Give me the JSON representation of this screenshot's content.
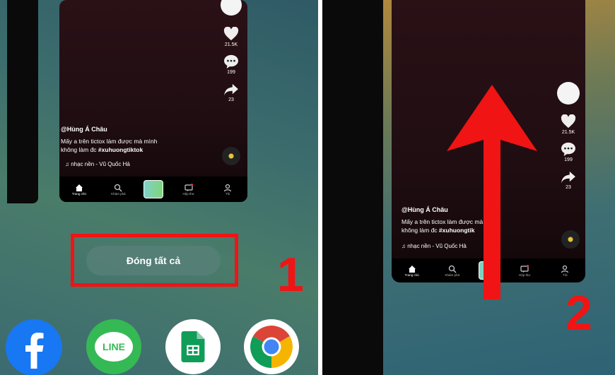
{
  "left_card": {
    "likes": "21.5K",
    "comments": "199",
    "shares": "23",
    "username": "@Hùng Á Châu",
    "caption_line1": "Mấy a trên tictox làm được mà mình",
    "caption_line2_prefix": "không làm đc ",
    "caption_hashtag": "#xuhuongtiktok",
    "music": "♫  nhạc nền - Vũ Quốc Hả"
  },
  "right_card": {
    "likes": "21.5K",
    "comments": "199",
    "shares": "23",
    "username": "@Hùng Á Châu",
    "caption_line1": "Mấy a trên tictox làm được mà minh",
    "caption_line2_prefix": "không làm đc ",
    "caption_hashtag": "#xuhuongtik",
    "music": "♫  nhạc nền - Vũ Quốc Hả"
  },
  "nav": {
    "home": "Trang chủ",
    "discover": "Khám phá",
    "inbox": "Hộp thư",
    "profile": "Tôi"
  },
  "close_all_label": "Đóng tất cả",
  "step1": "1",
  "step2": "2",
  "dock": {
    "line_label": "LINE"
  },
  "colors": {
    "highlight": "#f01414",
    "arrow": "#f01414",
    "facebook": "#1877f2",
    "line": "#35b955"
  }
}
